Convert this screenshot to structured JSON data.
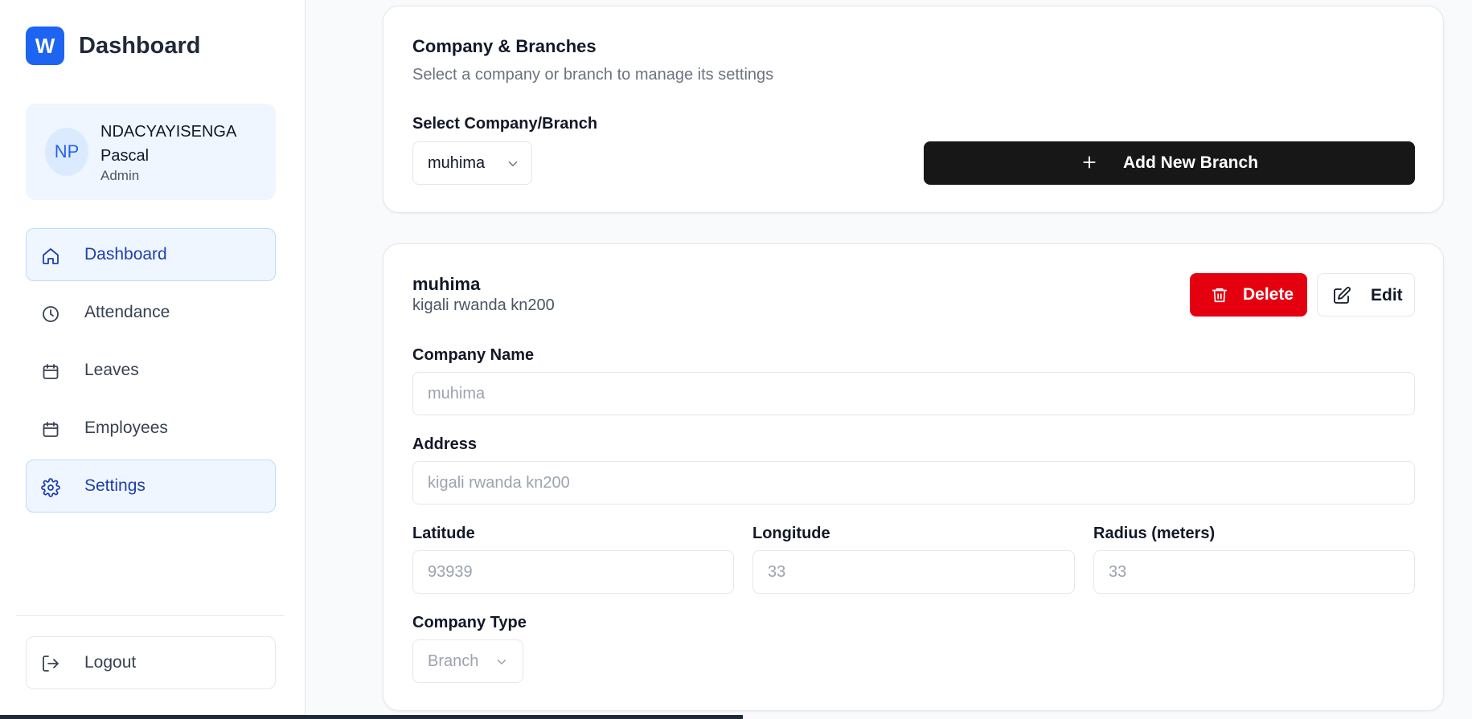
{
  "brand": {
    "logo_letter": "W",
    "title": "Dashboard",
    "accent": "#1d64f2"
  },
  "profile": {
    "initials": "NP",
    "name": "NDACYAYISENGA Pascal",
    "role": "Admin"
  },
  "nav": [
    {
      "label": "Dashboard",
      "icon": "home-icon",
      "active": true
    },
    {
      "label": "Attendance",
      "icon": "clock-icon",
      "active": false
    },
    {
      "label": "Leaves",
      "icon": "calendar-icon",
      "active": false
    },
    {
      "label": "Employees",
      "icon": "calendar-icon",
      "active": false
    },
    {
      "label": "Settings",
      "icon": "gear-icon",
      "active": true
    }
  ],
  "logout": {
    "label": "Logout",
    "icon": "logout-icon"
  },
  "company_card": {
    "title": "Company & Branches",
    "subtitle": "Select a company or branch to manage its settings",
    "select_label": "Select Company/Branch",
    "selected": "muhima",
    "add_button": "Add New Branch"
  },
  "branch_card": {
    "name": "muhima",
    "address": "kigali rwanda kn200",
    "delete_label": "Delete",
    "edit_label": "Edit",
    "delete_color": "#e5000f",
    "fields": {
      "company_name_label": "Company Name",
      "company_name_value": "muhima",
      "address_label": "Address",
      "address_value": "kigali rwanda kn200",
      "latitude_label": "Latitude",
      "latitude_value": "93939",
      "longitude_label": "Longitude",
      "longitude_value": "33",
      "radius_label": "Radius (meters)",
      "radius_value": "33",
      "company_type_label": "Company Type",
      "company_type_value": "Branch"
    }
  }
}
